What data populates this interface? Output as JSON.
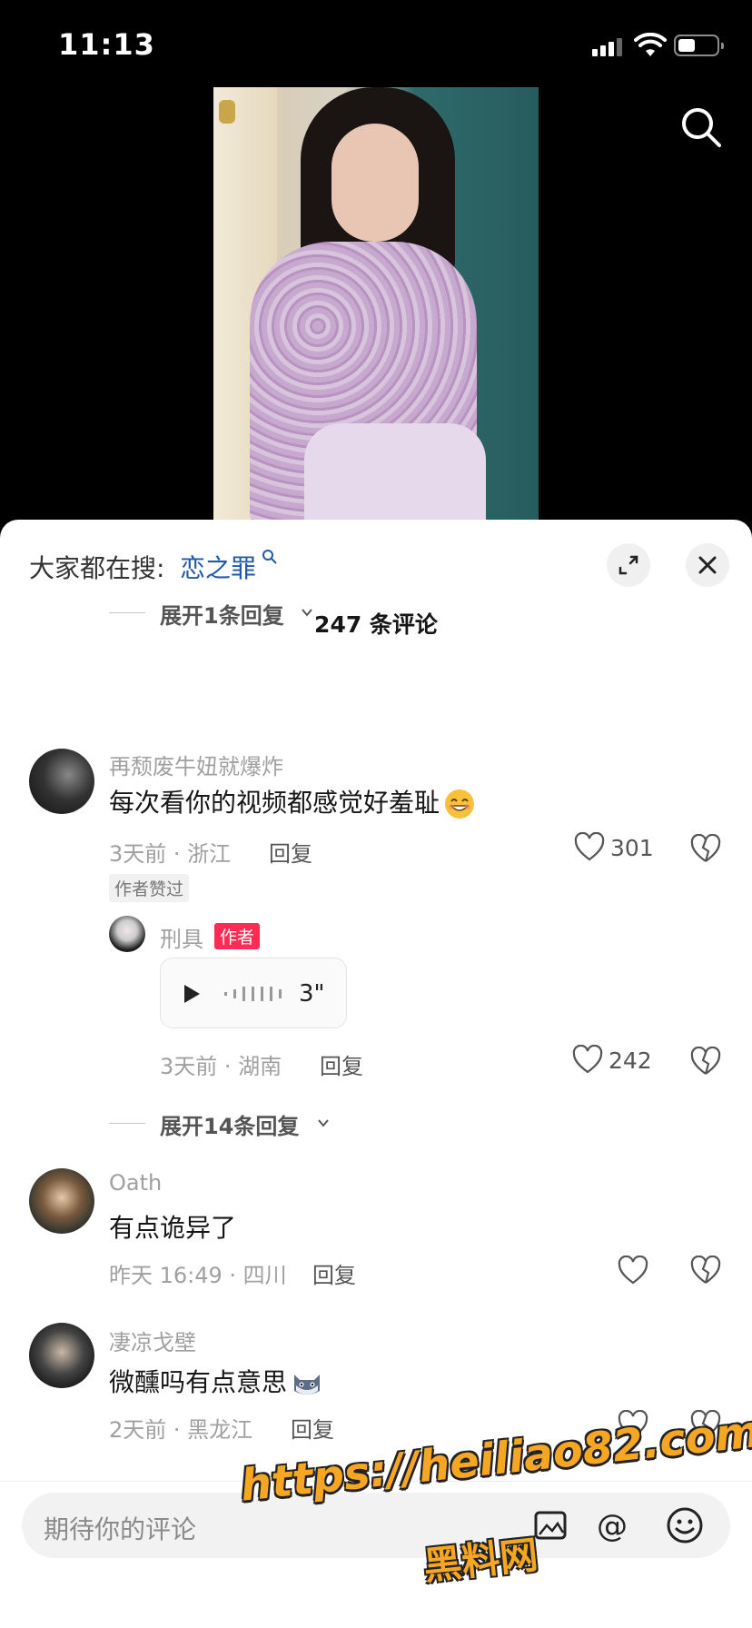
{
  "status_bar": {
    "time": "11:13",
    "battery_level": 0.45,
    "signal_bars": 3
  },
  "video": {
    "description_icon": "search-icon"
  },
  "panel": {
    "hot_search_prefix": "大家都在搜:",
    "hot_search_term": "恋之罪",
    "comment_count": "247 条评论"
  },
  "expand_top": {
    "label": "展开1条回复"
  },
  "comments": [
    {
      "username": "再颓废牛妞就爆炸",
      "text": "每次看你的视频都感觉好羞耻",
      "emoji": "grin-emoji",
      "meta": "3天前 · 浙江",
      "reply": "回复",
      "likes": "301",
      "badge": "作者赞过"
    },
    {
      "username": "Oath",
      "text": "有点诡异了",
      "meta": "昨天 16:49 · 四川",
      "reply": "回复",
      "likes": ""
    },
    {
      "username": "凄凉戈壁",
      "text": "微醺吗有点意思",
      "emoji": "cat-emoji",
      "meta": "2天前 · 黑龙江",
      "reply": "回复",
      "likes": ""
    }
  ],
  "author_reply": {
    "username": "刑具",
    "badge": "作者",
    "voice_duration": "3\"",
    "meta": "3天前 · 湖南",
    "reply": "回复",
    "likes": "242"
  },
  "expand_more": {
    "label": "展开14条回复"
  },
  "input_bar": {
    "placeholder": "期待你的评论"
  },
  "watermark": {
    "url": "https://heiliao82.com",
    "name": "黑料网"
  },
  "colors": {
    "accent": "#fe2c55",
    "link": "#1e5aa8",
    "watermark": "#f5a623"
  }
}
